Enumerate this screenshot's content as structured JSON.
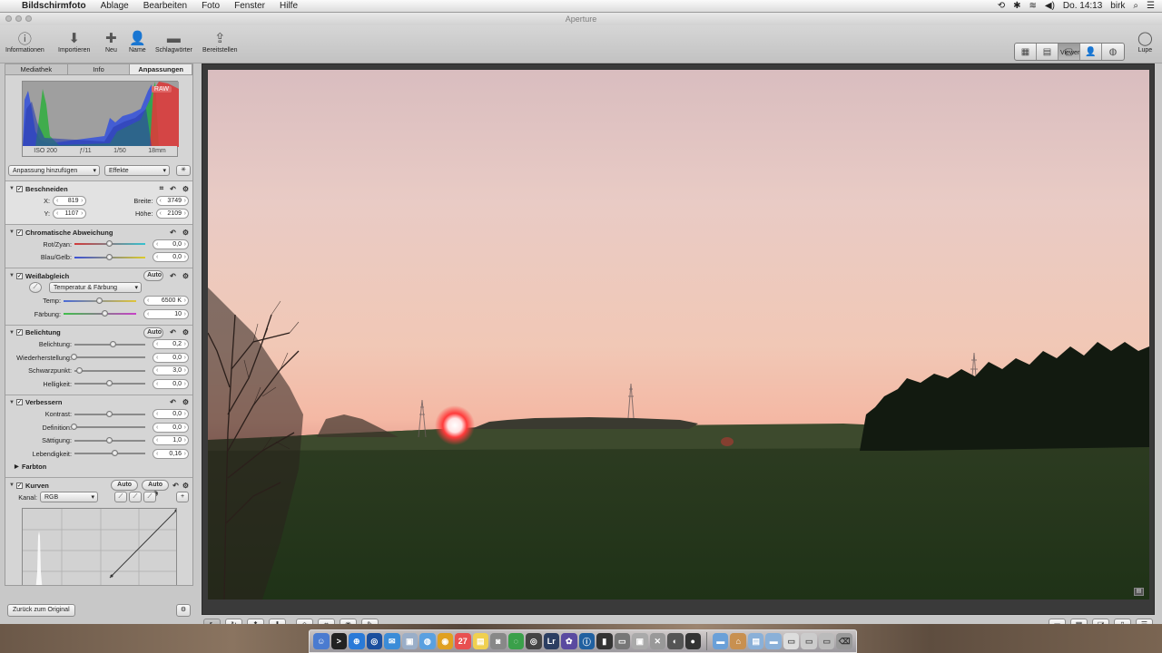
{
  "menubar": {
    "apple": "",
    "app_name": "Bildschirmfoto",
    "items": [
      "Ablage",
      "Bearbeiten",
      "Foto",
      "Fenster",
      "Hilfe"
    ],
    "clock": "Do. 14:13",
    "user": "birk"
  },
  "window": {
    "title": "Aperture"
  },
  "toolbar": {
    "info": "Informationen",
    "import": "Importieren",
    "new": "Neu",
    "name": "Name",
    "keywords": "Schlagwörter",
    "share": "Bereitstellen",
    "viewer": "Viewer",
    "loupe": "Lupe"
  },
  "inspector": {
    "tabs": [
      "Mediathek",
      "Info",
      "Anpassungen"
    ],
    "active_tab": "Anpassungen",
    "histogram": {
      "raw_badge": "RAW",
      "iso": "ISO 200",
      "aperture": "ƒ/11",
      "shutter": "1/50",
      "focal": "18mm"
    },
    "add_adjustment": "Anpassung hinzufügen",
    "effects": "Effekte",
    "crop": {
      "title": "Beschneiden",
      "x_label": "X:",
      "x": "819",
      "y_label": "Y:",
      "y": "1107",
      "w_label": "Breite:",
      "w": "3749",
      "h_label": "Höhe:",
      "h": "2109"
    },
    "chroma": {
      "title": "Chromatische Abweichung",
      "rc_label": "Rot/Zyan:",
      "rc": "0,0",
      "by_label": "Blau/Gelb:",
      "by": "0,0",
      "rc_level": 0.5,
      "by_level": 0.5
    },
    "wb": {
      "title": "Weißabgleich",
      "auto": "Auto",
      "mode": "Temperatur & Färbung",
      "temp_label": "Temp:",
      "temp": "6500 K",
      "tint_label": "Färbung:",
      "tint": "10",
      "temp_level": 0.5,
      "tint_level": 0.58
    },
    "exposure": {
      "title": "Belichtung",
      "auto": "Auto",
      "rows": [
        {
          "label": "Belichtung:",
          "value": "0,2",
          "level": 0.55
        },
        {
          "label": "Wiederherstellung:",
          "value": "0,0",
          "level": 0.0
        },
        {
          "label": "Schwarzpunkt:",
          "value": "3,0",
          "level": 0.08
        },
        {
          "label": "Helligkeit:",
          "value": "0,0",
          "level": 0.5
        }
      ]
    },
    "enhance": {
      "title": "Verbessern",
      "rows": [
        {
          "label": "Kontrast:",
          "value": "0,0",
          "level": 0.5
        },
        {
          "label": "Definition:",
          "value": "0,0",
          "level": 0.0
        },
        {
          "label": "Sättigung:",
          "value": "1,0",
          "level": 0.5
        },
        {
          "label": "Lebendigkeit:",
          "value": "0,16",
          "level": 0.58
        }
      ],
      "hue": "Farbton"
    },
    "curves": {
      "title": "Kurven",
      "auto1": "Auto",
      "auto2": "Auto",
      "channel_label": "Kanal:",
      "channel": "RGB"
    },
    "reset": "Zurück zum Original"
  },
  "colors": {
    "accent": "#3b6fd6",
    "window_bg": "#c8c8c8",
    "viewer_bg": "#3a3a3a"
  }
}
